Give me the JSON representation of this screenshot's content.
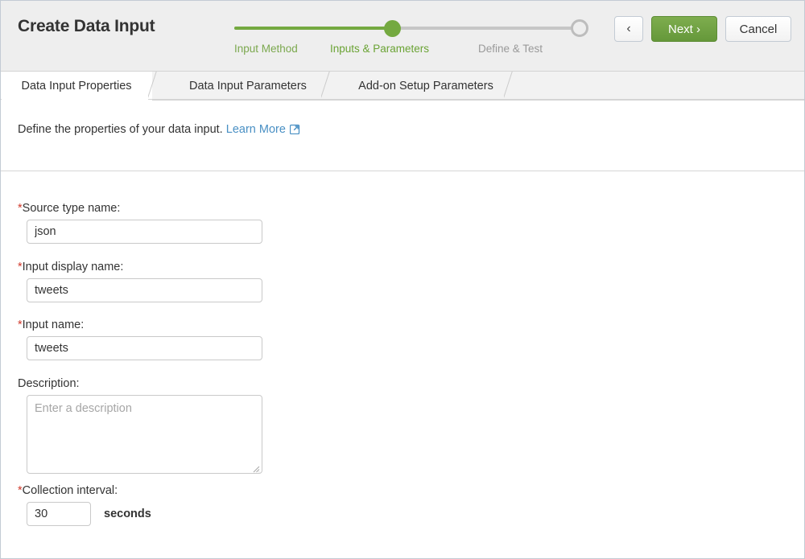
{
  "header": {
    "title": "Create Data Input",
    "wizard": {
      "steps": [
        {
          "label": "Input Method",
          "state": "completed"
        },
        {
          "label": "Inputs & Parameters",
          "state": "current"
        },
        {
          "label": "Define & Test",
          "state": "pending"
        }
      ],
      "progress_percent": 46,
      "accent_color": "#74a940",
      "inactive_color": "#c6c6c6"
    },
    "buttons": {
      "back_label": "‹",
      "next_label": "Next ›",
      "cancel_label": "Cancel"
    }
  },
  "tabs": [
    {
      "label": "Data Input Properties",
      "active": true
    },
    {
      "label": "Data Input Parameters",
      "active": false
    },
    {
      "label": "Add-on Setup Parameters",
      "active": false
    }
  ],
  "intro": {
    "text": "Define the properties of your data input.",
    "link_label": "Learn More",
    "link_color": "#4a90c4",
    "icon": "external-link-icon"
  },
  "form": {
    "required_marker": "*",
    "fields": [
      {
        "label": "Source type name:",
        "required": true,
        "value": "json",
        "placeholder": ""
      },
      {
        "label": "Input display name:",
        "required": true,
        "value": "tweets",
        "placeholder": ""
      },
      {
        "label": "Input name:",
        "required": true,
        "value": "tweets",
        "placeholder": ""
      },
      {
        "label": "Description:",
        "required": false,
        "value": "",
        "placeholder": "Enter a description"
      },
      {
        "label": "Collection interval:",
        "required": true,
        "value": "30",
        "placeholder": "",
        "unit": "seconds"
      }
    ]
  }
}
